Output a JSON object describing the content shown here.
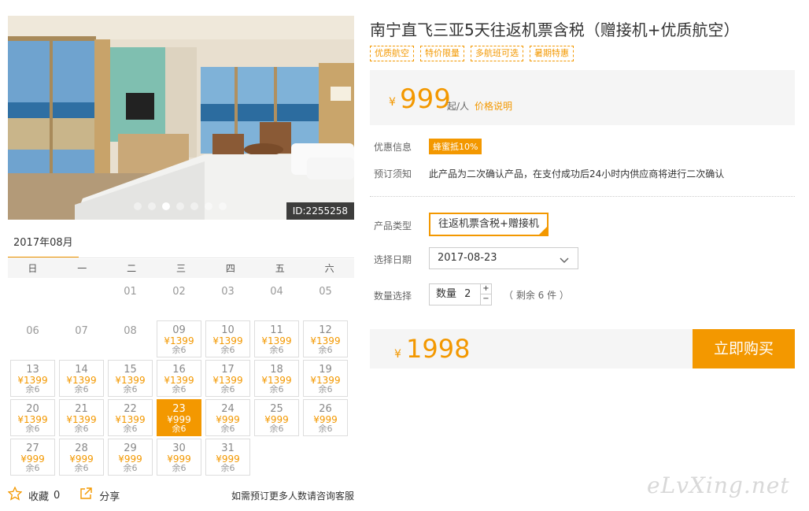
{
  "hero": {
    "id_tag": "ID:2255258",
    "dots": 7,
    "active_dot": 3
  },
  "calendar": {
    "month": "2017年08月",
    "weekdays": [
      "日",
      "一",
      "二",
      "三",
      "四",
      "五",
      "六"
    ],
    "days": [
      {
        "d": "",
        "av": false
      },
      {
        "d": "",
        "av": false
      },
      {
        "d": "01",
        "av": false
      },
      {
        "d": "02",
        "av": false
      },
      {
        "d": "03",
        "av": false
      },
      {
        "d": "04",
        "av": false
      },
      {
        "d": "05",
        "av": false
      },
      {
        "d": "06",
        "av": false
      },
      {
        "d": "07",
        "av": false
      },
      {
        "d": "08",
        "av": false
      },
      {
        "d": "09",
        "p": "¥1399",
        "s": "余6",
        "av": true
      },
      {
        "d": "10",
        "p": "¥1399",
        "s": "余6",
        "av": true
      },
      {
        "d": "11",
        "p": "¥1399",
        "s": "余6",
        "av": true
      },
      {
        "d": "12",
        "p": "¥1399",
        "s": "余6",
        "av": true
      },
      {
        "d": "13",
        "p": "¥1399",
        "s": "余6",
        "av": true
      },
      {
        "d": "14",
        "p": "¥1399",
        "s": "余6",
        "av": true
      },
      {
        "d": "15",
        "p": "¥1399",
        "s": "余6",
        "av": true
      },
      {
        "d": "16",
        "p": "¥1399",
        "s": "余6",
        "av": true
      },
      {
        "d": "17",
        "p": "¥1399",
        "s": "余6",
        "av": true
      },
      {
        "d": "18",
        "p": "¥1399",
        "s": "余6",
        "av": true
      },
      {
        "d": "19",
        "p": "¥1399",
        "s": "余6",
        "av": true
      },
      {
        "d": "20",
        "p": "¥1399",
        "s": "余6",
        "av": true
      },
      {
        "d": "21",
        "p": "¥1399",
        "s": "余6",
        "av": true
      },
      {
        "d": "22",
        "p": "¥1399",
        "s": "余6",
        "av": true
      },
      {
        "d": "23",
        "p": "¥999",
        "s": "余6",
        "av": true,
        "sel": true
      },
      {
        "d": "24",
        "p": "¥999",
        "s": "余6",
        "av": true
      },
      {
        "d": "25",
        "p": "¥999",
        "s": "余6",
        "av": true
      },
      {
        "d": "26",
        "p": "¥999",
        "s": "余6",
        "av": true
      },
      {
        "d": "27",
        "p": "¥999",
        "s": "余6",
        "av": true
      },
      {
        "d": "28",
        "p": "¥999",
        "s": "余6",
        "av": true
      },
      {
        "d": "29",
        "p": "¥999",
        "s": "余6",
        "av": true
      },
      {
        "d": "30",
        "p": "¥999",
        "s": "余6",
        "av": true
      },
      {
        "d": "31",
        "p": "¥999",
        "s": "余6",
        "av": true
      }
    ]
  },
  "footer": {
    "favorite_label": "收藏",
    "favorite_count": "0",
    "share_label": "分享",
    "note": "如需预订更多人数请咨询客服"
  },
  "product": {
    "title": "南宁直飞三亚5天往返机票含税（赠接机+优质航空）",
    "tags": [
      "优质航空",
      "特价限量",
      "多航班可选",
      "暑期特惠"
    ],
    "price_symbol": "¥",
    "price": "999",
    "price_unit": "起/人",
    "price_link": "价格说明",
    "discount_label": "优惠信息",
    "discount_badge": "蜂蜜抵10%",
    "notice_label": "预订须知",
    "notice_text": "此产品为二次确认产品，在支付成功后24小时内供应商将进行二次确认",
    "type_label": "产品类型",
    "type_value": "往返机票含税+赠接机",
    "date_label": "选择日期",
    "date_value": "2017-08-23",
    "qty_label": "数量选择",
    "qty_prefix": "数量",
    "qty_value": "2",
    "remain_text": "（ 剩余 6 件 ）",
    "total_symbol": "¥",
    "total": "1998",
    "buy_label": "立即购买"
  },
  "watermark": "eLvXing.net",
  "colors": {
    "accent": "#f39800"
  }
}
